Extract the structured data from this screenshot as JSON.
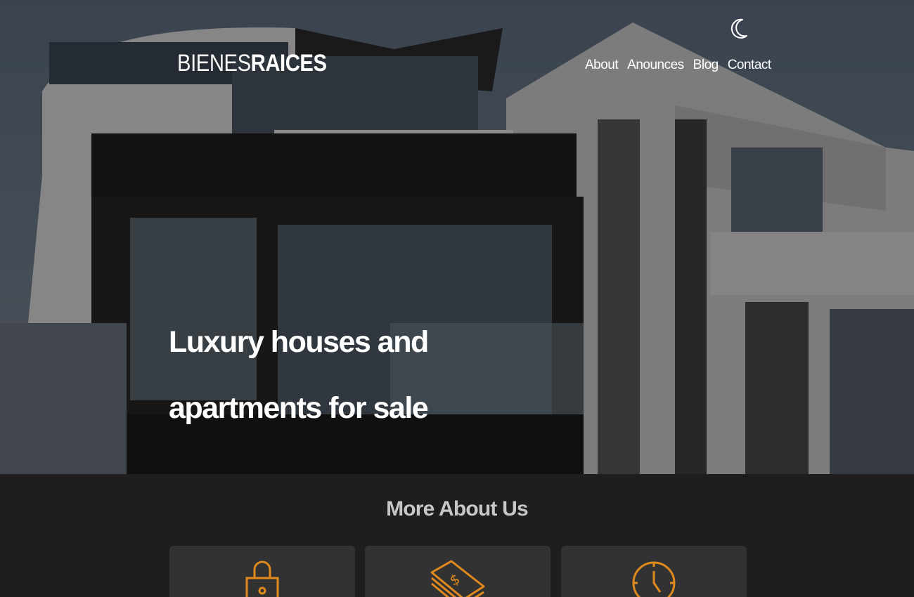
{
  "header": {
    "logo_thin": "BIENES",
    "logo_bold": "RAICES",
    "mode_icon": "moon-icon",
    "nav": [
      {
        "label": "About"
      },
      {
        "label": "Anounces"
      },
      {
        "label": "Blog"
      },
      {
        "label": "Contact"
      }
    ]
  },
  "hero": {
    "title": "Luxury houses and apartments for sale"
  },
  "about": {
    "title": "More About Us",
    "cards": [
      {
        "icon": "lock-icon"
      },
      {
        "icon": "money-icon"
      },
      {
        "icon": "clock-icon"
      }
    ]
  },
  "colors": {
    "accent": "#e08a1e",
    "section_bg": "#1e1e1e",
    "card_bg": "#323232"
  }
}
